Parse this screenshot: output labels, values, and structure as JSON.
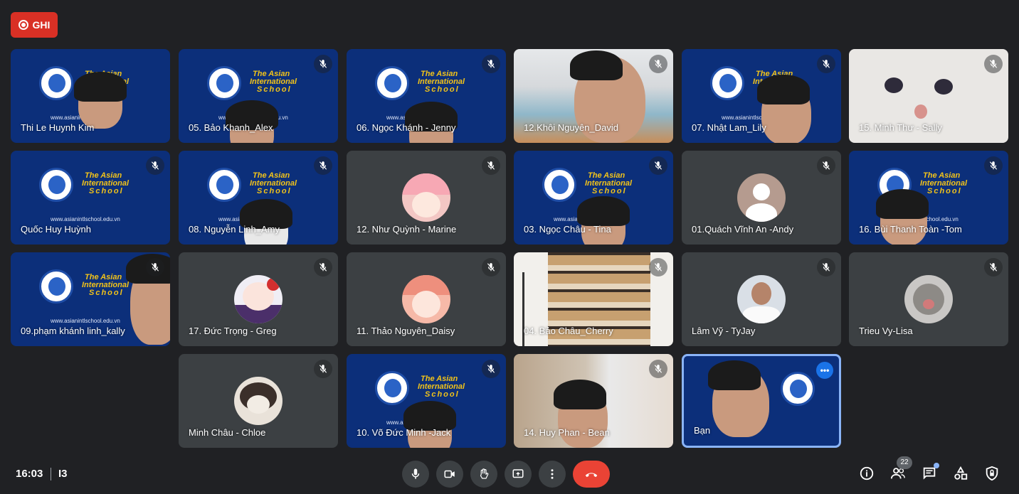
{
  "record_label": "GHI",
  "time": "16:03",
  "meeting_code": "I3",
  "participants_count": "22",
  "school": {
    "line1": "The Asian",
    "line2": "International",
    "line3": "School",
    "website": "www.asianintlschool.edu.vn"
  },
  "tiles": [
    {
      "name": "Thi Le Huynh Kim"
    },
    {
      "name": "05. Bảo Khanh_Alex"
    },
    {
      "name": "06. Ngọc Khánh - Jenny"
    },
    {
      "name": "12.Khôi Nguyên_David"
    },
    {
      "name": "07. Nhật Lam_Lily"
    },
    {
      "name": "15. Minh Thư - Sally"
    },
    {
      "name": "Quốc Huy Huỳnh"
    },
    {
      "name": "08. Nguyễn Linh_Amy"
    },
    {
      "name": "12. Như Quỳnh - Marine"
    },
    {
      "name": "03. Ngọc Châu - Tina"
    },
    {
      "name": "01.Quách Vĩnh An -Andy"
    },
    {
      "name": "16. Bùi Thanh Toàn -Tom"
    },
    {
      "name": "09.phạm khánh linh_kally"
    },
    {
      "name": "17. Đức Trọng - Greg"
    },
    {
      "name": "11. Thảo Nguyên_Daisy"
    },
    {
      "name": "04. Bảo Châu_Cherry"
    },
    {
      "name": "Lâm Vỹ - TyJay"
    },
    {
      "name": "Trieu Vy-Lisa"
    },
    {
      "name": "Minh Châu - Chloe"
    },
    {
      "name": "10. Võ Đức Minh -Jack"
    },
    {
      "name": "14. Huy Phan - Bean"
    },
    {
      "name": "Bạn"
    }
  ],
  "colors": {
    "background": "#202124",
    "tile": "#3c4043",
    "end_call": "#ea4335",
    "record": "#d93025",
    "accent": "#8ab4f8"
  }
}
